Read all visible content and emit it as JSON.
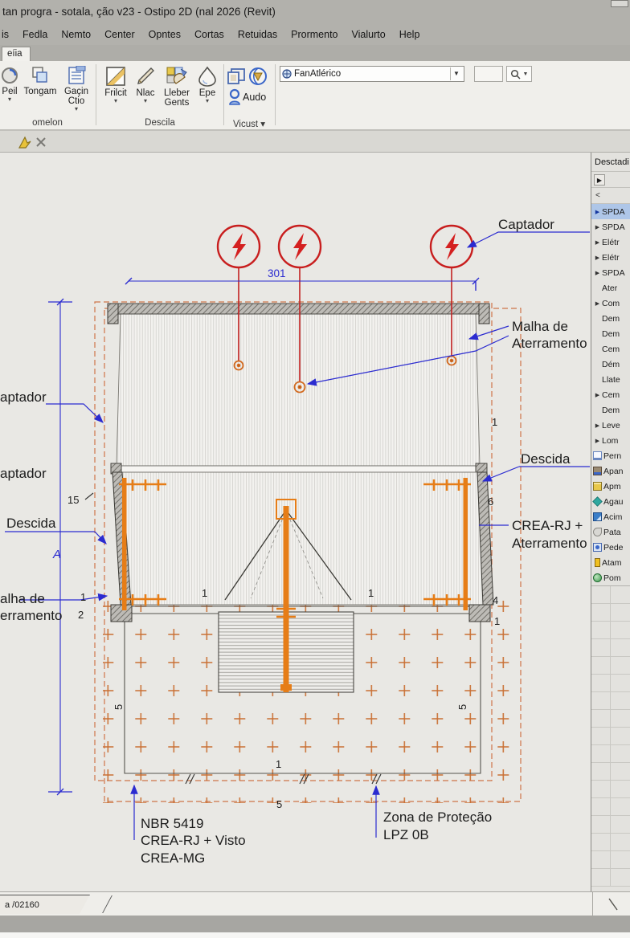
{
  "window": {
    "title": "tan progra - sotala, ção v23 - Ostipo 2D (nal 2026 (Revit)"
  },
  "menu": {
    "items": [
      "is",
      "Fedla",
      "Nemto",
      "Center",
      "Opntes",
      "Cortas",
      "Retuidas",
      "Prormento",
      "Vialurto",
      "Help"
    ]
  },
  "ribbon": {
    "tab": "eíia",
    "groups": [
      {
        "label": "omelon",
        "buttons": [
          {
            "label": "Peil",
            "caret": "▾"
          },
          {
            "label": "Tongam"
          },
          {
            "label": "Gaçin",
            "label2": "Ctio",
            "caret": "▾"
          }
        ]
      },
      {
        "label": "Descila",
        "buttons": [
          {
            "label": "Frilcit",
            "caret": "▾"
          },
          {
            "label": "Nlac",
            "caret": "▾"
          },
          {
            "label": "Lleber",
            "label2": "Gents"
          },
          {
            "label": "Epe",
            "caret": "▾"
          }
        ]
      },
      {
        "label": "Vicust ▾",
        "buttons": [
          {
            "label": "Audo"
          }
        ]
      }
    ],
    "search": {
      "value": "FanAtlérico"
    }
  },
  "browser": {
    "title": "Desctadi",
    "toolbar": {
      "forward": "▶",
      "back": "<"
    },
    "items": [
      {
        "label": "SPDA",
        "expand": true,
        "selected": true
      },
      {
        "label": "SPDA",
        "expand": true
      },
      {
        "label": "Elétr",
        "expand": true
      },
      {
        "label": "Elétr",
        "expand": true
      },
      {
        "label": "SPDA",
        "expand": true
      },
      {
        "label": "Ater"
      },
      {
        "label": "Com",
        "expand": true
      },
      {
        "label": "Dem"
      },
      {
        "label": "Dem"
      },
      {
        "label": "Cem"
      },
      {
        "label": "Dém"
      },
      {
        "label": "Llate"
      },
      {
        "label": "Cem",
        "expand": true
      },
      {
        "label": "Dem"
      },
      {
        "label": "Leve",
        "expand": true
      },
      {
        "label": "Lom",
        "expand": true
      },
      {
        "label": "Pern",
        "icon": "sheet-icon"
      },
      {
        "label": "Apan",
        "icon": "printer-icon"
      },
      {
        "label": "Apm",
        "icon": "card-icon"
      },
      {
        "label": "Agau",
        "icon": "teal-diamond-icon"
      },
      {
        "label": "Acim",
        "icon": "blue-material-icon"
      },
      {
        "label": "Pata",
        "icon": "gray-drop-icon"
      },
      {
        "label": "Pede",
        "icon": "group-icon"
      },
      {
        "label": "Atam",
        "icon": "yellow-bar-icon"
      },
      {
        "label": "Pom",
        "icon": "globe2-icon"
      }
    ]
  },
  "drawing": {
    "labels": {
      "captador_top": "Captador",
      "captador_left_1": "aptador",
      "captador_left_2": "aptador",
      "descida_left": "Descida",
      "malha_left_1": "alha de",
      "malha_left_2": "erramento",
      "malha_right_1": "Malha de",
      "malha_right_2": "Aterramento",
      "descida_right": "Descida",
      "crea_right_1": "CREA-RJ +",
      "crea_right_2": "Aterramento",
      "nbr_1": "NBR 5419",
      "nbr_2": "CREA-RJ + Visto",
      "nbr_3": "CREA-MG",
      "zona_1": "Zona de Proteção",
      "zona_2": "LPZ 0B"
    },
    "dims": {
      "top": "301",
      "axis": "A",
      "left_15": "15",
      "left_1": "1",
      "left_2": "2",
      "right_1": "1",
      "right_6": "6",
      "right_4": "4",
      "right_1b": "1",
      "mid_1l": "1",
      "mid_1r": "1",
      "bottom_1": "1",
      "bottom_5": "5",
      "rot_5l": "5",
      "rot_5r": "5"
    }
  },
  "statusbar": {
    "tab": "a /02160"
  },
  "colors": {
    "annotation_blue": "#2b2bd0",
    "cad_red": "#c81e1e",
    "cad_orange": "#e67d17",
    "dash_orange": "#cf7549"
  }
}
